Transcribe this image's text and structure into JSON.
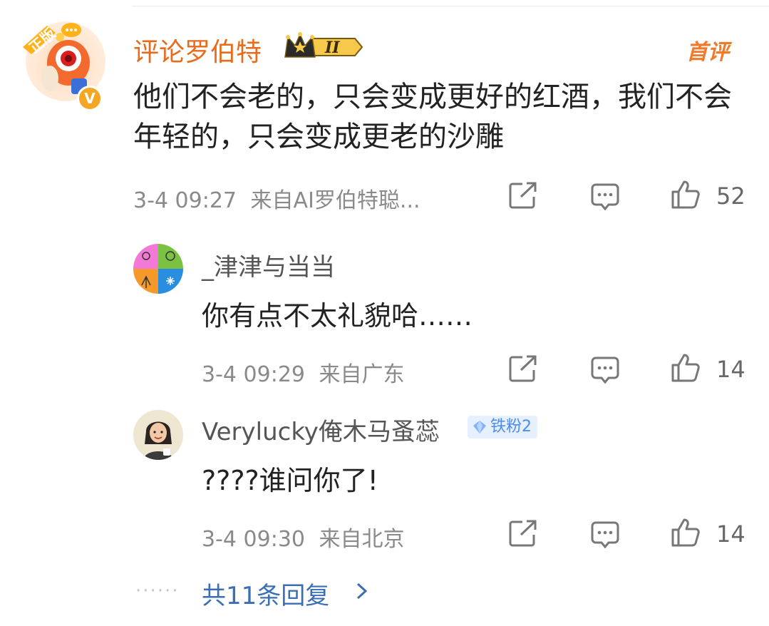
{
  "top_comment": {
    "username": "评论罗伯特",
    "level_badge": "II",
    "hot_tag": "首评",
    "pendant_text": "正版",
    "text": "他们不会老的，只会变成更好的红酒，我们不会年轻的，只会变成更老的沙雕",
    "time": "3-4 09:27",
    "source": "来自AI罗伯特聪...",
    "likes": "52"
  },
  "replies": [
    {
      "username": "_津津与当当",
      "text": "你有点不太礼貌哈……",
      "time": "3-4 09:29",
      "source": "来自广东",
      "likes": "14"
    },
    {
      "username": "Verylucky俺木马蚤蕊",
      "fan_badge": "铁粉2",
      "text": "????谁问你了!",
      "time": "3-4 09:30",
      "source": "来自北京",
      "likes": "14"
    }
  ],
  "more": {
    "dots": "······",
    "label": "共11条回复"
  },
  "colors": {
    "username_vip": "#e86b1c",
    "link": "#3a6fb5",
    "meta": "#8a8a8a",
    "badge_bg": "#e6f0ff",
    "badge_text": "#4a8cf0"
  }
}
